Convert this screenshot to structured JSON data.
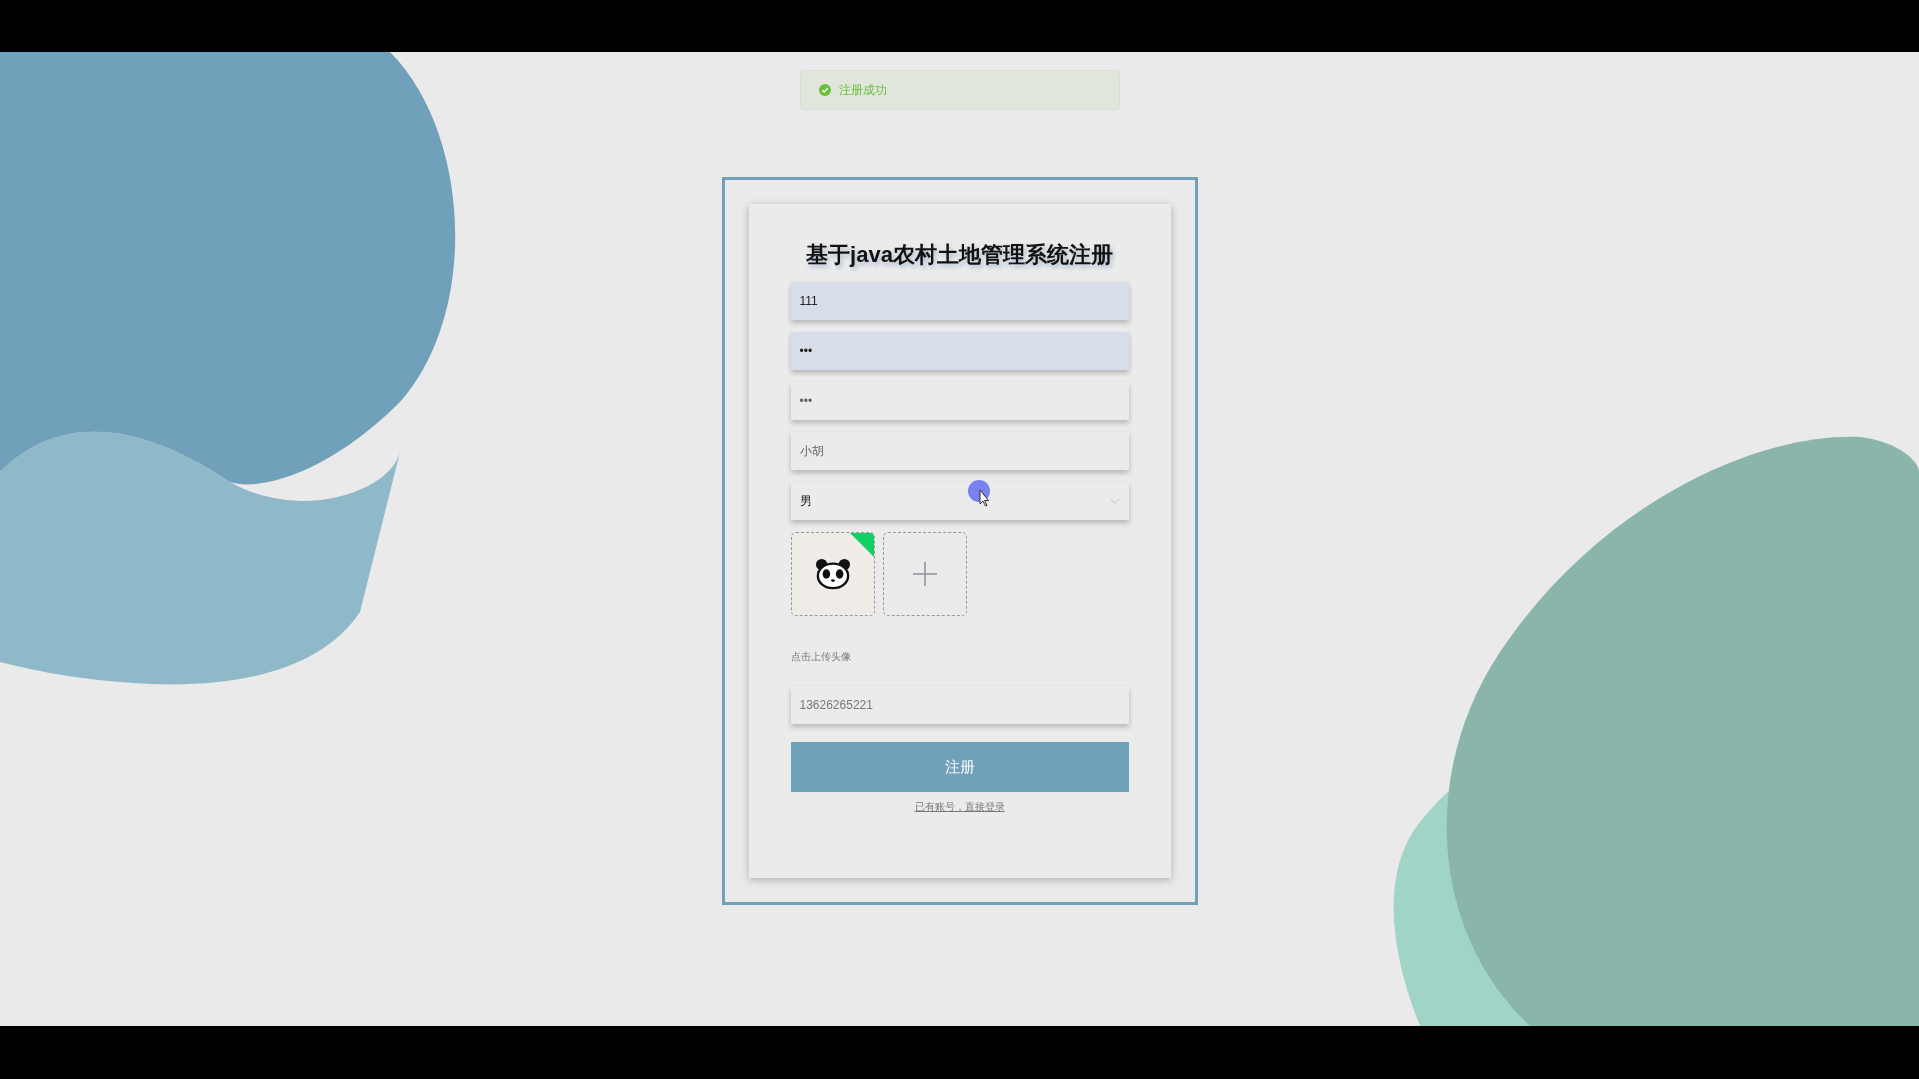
{
  "toast": {
    "kind": "success",
    "text": "注册成功"
  },
  "form": {
    "title": "基于java农村土地管理系统注册",
    "fields": [
      {
        "kind": "input",
        "value": "111",
        "autofilled": true
      },
      {
        "kind": "input",
        "value": "•••",
        "autofilled": true
      },
      {
        "kind": "input",
        "value": "•••",
        "autofilled": false
      },
      {
        "kind": "input",
        "value": "小胡",
        "autofilled": false
      },
      {
        "kind": "select",
        "value": "男",
        "autofilled": false
      }
    ],
    "upload": {
      "uploaded": true,
      "hint": "点击上传头像"
    },
    "phone": {
      "value": "13626265221"
    },
    "submit": "注册",
    "login_link": "已有账号，直接登录"
  }
}
